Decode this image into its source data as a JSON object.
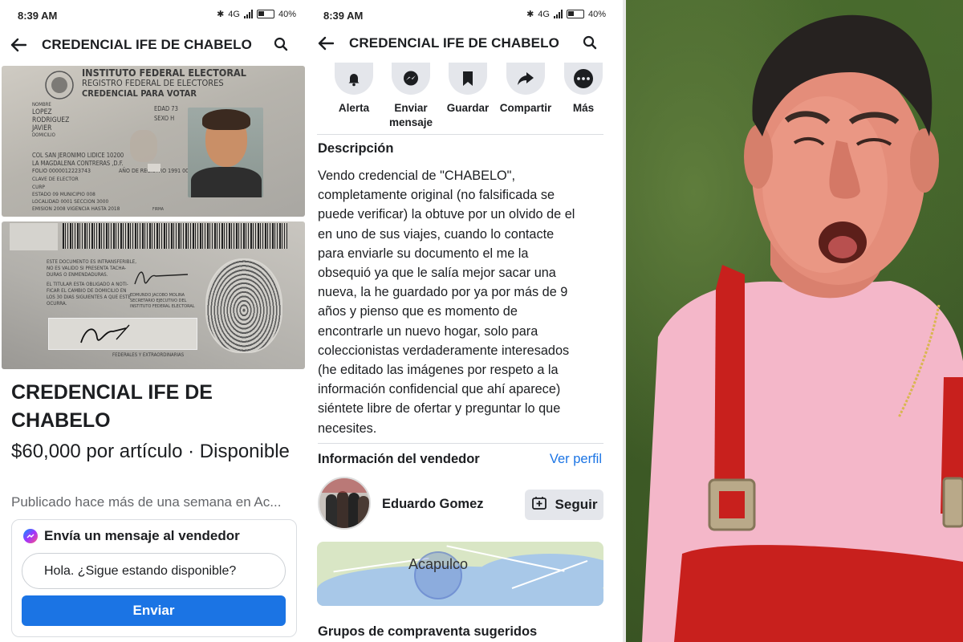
{
  "status_left": {
    "time": "8:39 AM",
    "battery": "40%",
    "net": "4G"
  },
  "status_mid": {
    "time": "8:39 AM",
    "battery": "40%",
    "net": "4G"
  },
  "listing": {
    "title": "CREDENCIAL IFE DE CHABELO",
    "heading": "CREDENCIAL IFE DE\nCHABELO",
    "price": "$60,000 por artículo · Disponible",
    "published": "Publicado hace más de una semana en Ac...",
    "message_header": "Envía un mensaje al vendedor",
    "message_value": "Hola. ¿Sigue estando disponible?",
    "send_label": "Enviar"
  },
  "card_front": {
    "institute": "INSTITUTO FEDERAL ELECTORAL",
    "registry": "REGISTRO FEDERAL DE ELECTORES",
    "credential": "CREDENCIAL PARA VOTAR",
    "name_label": "NOMBRE",
    "name1": "LOPEZ",
    "name2": "RODRIGUEZ",
    "name3": "JAVIER",
    "age": "EDAD 73",
    "sex": "SEXO H",
    "address_label": "DOMICILIO",
    "address1": "COL SAN JERONIMO LIDICE 10200",
    "address2": "LA MAGDALENA CONTRERAS ,D.F.",
    "folio": "FOLIO 0000012223743",
    "year_reg": "AÑO DE REGISTRO 1991 00",
    "elector": "CLAVE DE ELECTOR",
    "curp": "CURP",
    "estado": "ESTADO 09  MUNICIPIO 008",
    "localidad": "LOCALIDAD 0001  SECCION 3000",
    "emision": "EMISION 2008  VIGENCIA HASTA 2018",
    "firma": "FIRMA"
  },
  "card_back": {
    "line1": "ESTE DOCUMENTO ES INTRANSFERIBLE,",
    "line2": "NO ES VALIDO SI PRESENTA TACHA-",
    "line3": "DURAS O ENMENDADURAS.",
    "line4": "EL TITULAR ESTA OBLIGADO A NOTI-",
    "line5": "FICAR EL CAMBIO DE DOMICILIO EN",
    "line6": "LOS 30 DIAS SIGUIENTES A QUE ESTE",
    "line7": "OCURRA.",
    "signer": "EDMUNDO JACOBO MOLINA",
    "signer_title": "SECRETARIO EJECUTIVO DEL",
    "signer_inst": "INSTITUTO FEDERAL ELECTORAL",
    "federal": "FEDERALES Y EXTRAORDINARIAS"
  },
  "actions": [
    {
      "label": "Alerta",
      "icon": "bell-icon"
    },
    {
      "label": "Enviar mensaje",
      "icon": "messenger-icon"
    },
    {
      "label": "Guardar",
      "icon": "bookmark-icon"
    },
    {
      "label": "Compartir",
      "icon": "share-icon"
    },
    {
      "label": "Más",
      "icon": "more-icon"
    }
  ],
  "description": {
    "heading": "Descripción",
    "body": "Vendo credencial de \"CHABELO\",\ncompletamente original (no falsificada se\npuede verificar) la obtuve por un olvido de el\nen uno de sus viajes, cuando lo contacte\npara enviarle su documento el me la\nobsequió ya que le salía mejor sacar una\nnueva, la he guardado por ya por más de 9\naños y pienso que es momento de\nencontrarle un nuevo hogar, solo para\ncoleccionistas verdaderamente interesados\n(he editado las imágenes por respeto a la\ninformación confidencial que ahí aparece)\nsiéntete libre de ofertar y preguntar lo que\nnecesites."
  },
  "seller": {
    "heading": "Información del vendedor",
    "link": "Ver perfil",
    "name": "Eduardo Gomez",
    "follow_label": "Seguir"
  },
  "map": {
    "city": "Acapulco"
  },
  "groups_heading": "Grupos de compraventa sugeridos",
  "colors": {
    "accent": "#1b74e4",
    "secondary_text": "#65676b",
    "chip": "#e4e6eb"
  }
}
